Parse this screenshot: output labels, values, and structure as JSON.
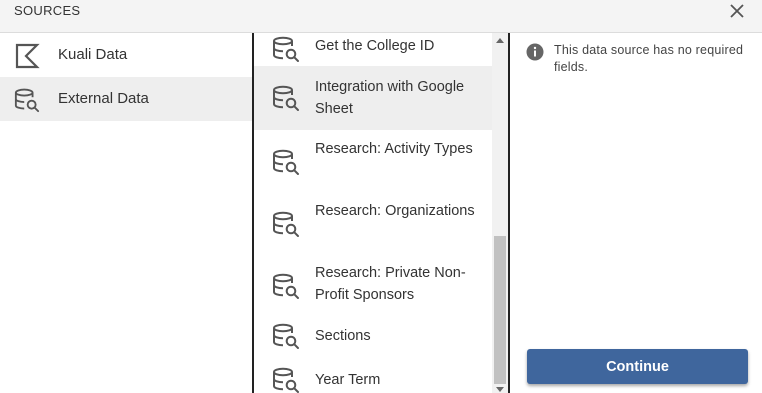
{
  "header": {
    "title": "SOURCES",
    "close_icon": "close-icon"
  },
  "sidebar": {
    "items": [
      {
        "label": "Kuali Data",
        "icon": "kuali-logo-icon",
        "active": false
      },
      {
        "label": "External Data",
        "icon": "database-search-icon",
        "active": true
      }
    ]
  },
  "list": {
    "items": [
      {
        "label": "Get the College ID",
        "icon": "database-search-icon"
      },
      {
        "label": "Integration with Google Sheet",
        "icon": "database-search-icon",
        "highlighted": true
      },
      {
        "label": "Research: Activity Types",
        "icon": "database-search-icon"
      },
      {
        "label": "Research: Organizations",
        "icon": "database-search-icon"
      },
      {
        "label": "Research: Private Non-Profit Sponsors",
        "icon": "database-search-icon"
      },
      {
        "label": "Sections",
        "icon": "database-search-icon"
      },
      {
        "label": "Year Term",
        "icon": "database-search-icon"
      }
    ]
  },
  "info": {
    "icon": "info-icon",
    "text": "This data source has no required fields."
  },
  "actions": {
    "continue_label": "Continue"
  },
  "colors": {
    "primary": "#3f669d",
    "active_bg": "#eeeeee",
    "header_bg": "#f4f4f4"
  }
}
